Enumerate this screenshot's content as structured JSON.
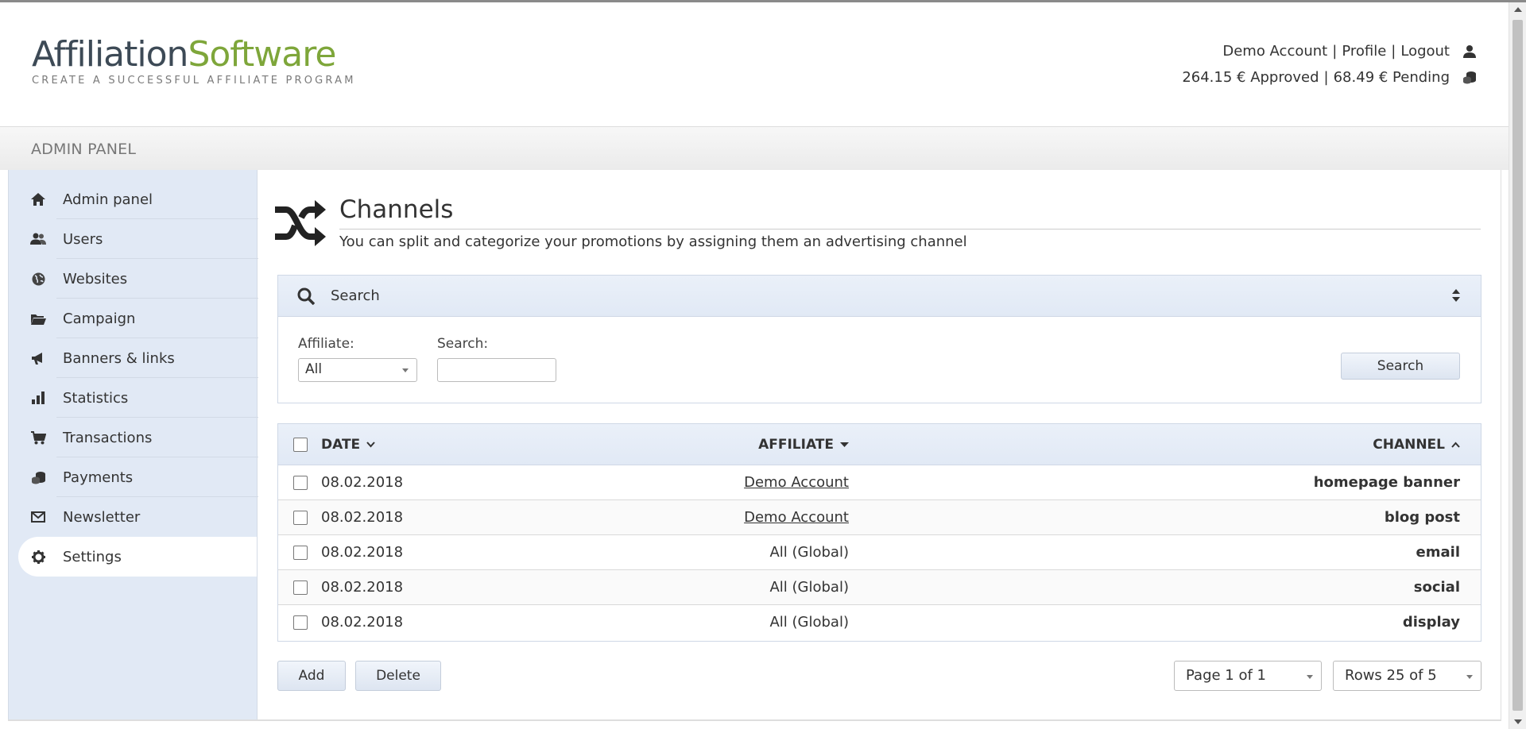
{
  "header": {
    "logo": {
      "part1": "Affiliation",
      "part2": "Software",
      "tagline": "CREATE A SUCCESSFUL AFFILIATE PROGRAM"
    },
    "account": {
      "name": "Demo Account",
      "separator": "|",
      "profile": "Profile",
      "logout": "Logout",
      "approved": "264.15 € Approved",
      "pending": "68.49 € Pending"
    }
  },
  "admin_bar": {
    "title": "ADMIN PANEL"
  },
  "sidebar": {
    "items": [
      {
        "label": "Admin panel",
        "icon": "home-icon"
      },
      {
        "label": "Users",
        "icon": "users-icon"
      },
      {
        "label": "Websites",
        "icon": "globe-icon"
      },
      {
        "label": "Campaign",
        "icon": "folder-icon"
      },
      {
        "label": "Banners & links",
        "icon": "megaphone-icon"
      },
      {
        "label": "Statistics",
        "icon": "bar-chart-icon"
      },
      {
        "label": "Transactions",
        "icon": "cart-icon"
      },
      {
        "label": "Payments",
        "icon": "coins-icon"
      },
      {
        "label": "Newsletter",
        "icon": "envelope-icon"
      },
      {
        "label": "Settings",
        "icon": "gear-icon",
        "active": true
      }
    ]
  },
  "page": {
    "title": "Channels",
    "description": "You can split and categorize your promotions by assigning them an advertising channel"
  },
  "search": {
    "title": "Search",
    "affiliate_label": "Affiliate:",
    "affiliate_value": "All",
    "search_label": "Search:",
    "search_value": "",
    "button": "Search"
  },
  "table": {
    "columns": {
      "date": "DATE",
      "affiliate": "AFFILIATE",
      "channel": "CHANNEL"
    },
    "rows": [
      {
        "date": "08.02.2018",
        "affiliate": "Demo Account",
        "channel": "homepage banner"
      },
      {
        "date": "08.02.2018",
        "affiliate": "Demo Account",
        "channel": "blog post"
      },
      {
        "date": "08.02.2018",
        "affiliate": "All (Global)",
        "channel": "email"
      },
      {
        "date": "08.02.2018",
        "affiliate": "All (Global)",
        "channel": "social"
      },
      {
        "date": "08.02.2018",
        "affiliate": "All (Global)",
        "channel": "display"
      }
    ]
  },
  "actions": {
    "add": "Add",
    "delete": "Delete"
  },
  "pagination": {
    "page": "Page 1 of 1",
    "rows": "Rows 25 of 5"
  },
  "colors": {
    "accent_green": "#7ea63a",
    "logo_dark": "#3d4a56",
    "sidebar_bg": "#e1e9f5"
  }
}
